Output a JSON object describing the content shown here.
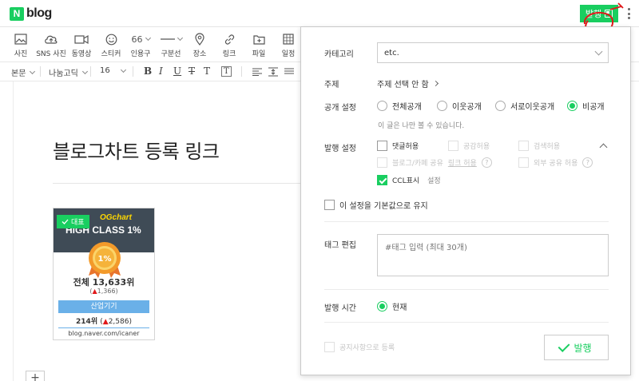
{
  "header": {
    "logo_n": "N",
    "logo_text": "blog",
    "publish_label": "발행"
  },
  "toolbar": {
    "items": [
      {
        "label": "사진",
        "icon": "image-icon"
      },
      {
        "label": "SNS 사진",
        "icon": "cloud-upload-icon"
      },
      {
        "label": "동영상",
        "icon": "video-icon"
      },
      {
        "label": "스티커",
        "icon": "smiley-icon"
      },
      {
        "label": "인용구",
        "icon": "quote-icon",
        "glyph": "66"
      },
      {
        "label": "구분선",
        "icon": "divider-icon"
      },
      {
        "label": "장소",
        "icon": "map-pin-icon"
      },
      {
        "label": "링크",
        "icon": "link-icon"
      },
      {
        "label": "파일",
        "icon": "file-plus-icon"
      },
      {
        "label": "일정",
        "icon": "calendar-icon"
      }
    ]
  },
  "formatbar": {
    "paragraph_style": "본문",
    "font": "나눔고딕",
    "font_size": "16",
    "bold": "B",
    "italic": "I",
    "underline": "U",
    "strike": "T",
    "text_color": "T",
    "text_bg": "T"
  },
  "editor": {
    "title": "블로그차트 등록 링크",
    "badge": {
      "rep_label": "대표",
      "brand": "OGchart",
      "class_label": "HIGH CLASS 1%",
      "medal_text": "1%",
      "total_rank": "전체 13,633위",
      "total_change": "1,366",
      "category": "산업기기",
      "category_rank": "214위",
      "category_change": "2,586",
      "url": "blog.naver.com/icaner"
    },
    "add_label": "+"
  },
  "panel": {
    "category_label": "카테고리",
    "category_value": "etc.",
    "topic_label": "주제",
    "topic_value": "주제 선택 안 함",
    "visibility_label": "공개 설정",
    "visibility_options": [
      "전체공개",
      "이웃공개",
      "서로이웃공개",
      "비공개"
    ],
    "visibility_selected": 3,
    "visibility_hint": "이 글은 나만 볼 수 있습니다.",
    "publish_settings_label": "발행 설정",
    "allow_comments": "댓글허용",
    "allow_sympathy": "공감허용",
    "allow_search": "검색허용",
    "allow_blog_cafe": "블로그/카페 공유",
    "link_allow": "링크 허용",
    "external_share": "외부 공유 허용",
    "ccl": "CCL표시",
    "ccl_setting": "설정",
    "keep_default": "이 설정을 기본값으로 유지",
    "tag_label": "태그 편집",
    "tag_placeholder": "#태그 입력 (최대 30개)",
    "publish_time_label": "발행 시간",
    "publish_time_now": "현재",
    "notice_register": "공지사항으로 등록",
    "publish_button": "발행"
  },
  "colors": {
    "accent": "#19ce60",
    "badge_dark": "#3f4b56",
    "badge_blue": "#6ab0e8",
    "annotation": "#e0191b"
  }
}
